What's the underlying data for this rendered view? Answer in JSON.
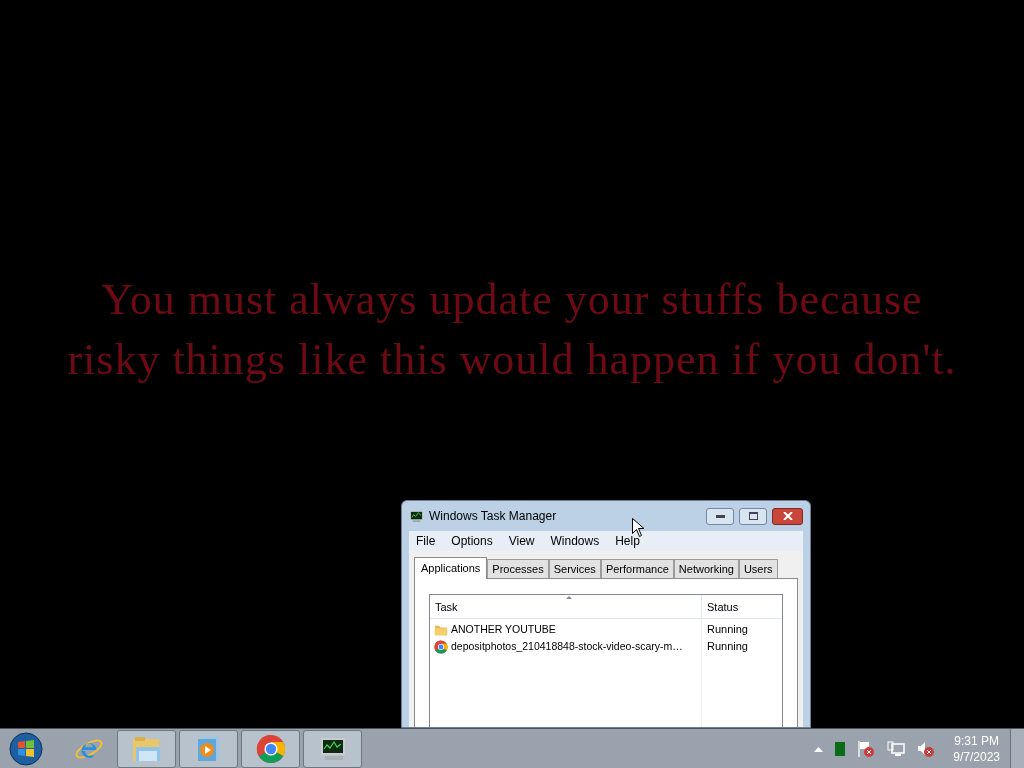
{
  "desktop": {
    "message_lines": [
      "You must always update your stuffs because",
      "risky things like this would happen if you don't."
    ]
  },
  "window": {
    "title": "Windows Task Manager",
    "menu": [
      "File",
      "Options",
      "View",
      "Windows",
      "Help"
    ],
    "tabs": [
      {
        "label": "Applications",
        "selected": true
      },
      {
        "label": "Processes",
        "selected": false
      },
      {
        "label": "Services",
        "selected": false
      },
      {
        "label": "Performance",
        "selected": false
      },
      {
        "label": "Networking",
        "selected": false
      },
      {
        "label": "Users",
        "selected": false
      }
    ],
    "table": {
      "columns": [
        "Task",
        "Status"
      ],
      "rows": [
        {
          "kind": "folder",
          "task": "ANOTHER YOUTUBE",
          "status": "Running"
        },
        {
          "kind": "chrome",
          "task": "depositphotos_210418848-stock-video-scary-m…",
          "status": "Running"
        }
      ]
    }
  },
  "taskbar": {
    "items": [
      {
        "kind": "ie",
        "running": false
      },
      {
        "kind": "explorer",
        "running": true
      },
      {
        "kind": "media",
        "running": true
      },
      {
        "kind": "chrome",
        "running": true
      },
      {
        "kind": "taskmgr",
        "running": true
      }
    ],
    "clock": {
      "time": "9:31 PM",
      "date": "9/7/2023"
    }
  }
}
